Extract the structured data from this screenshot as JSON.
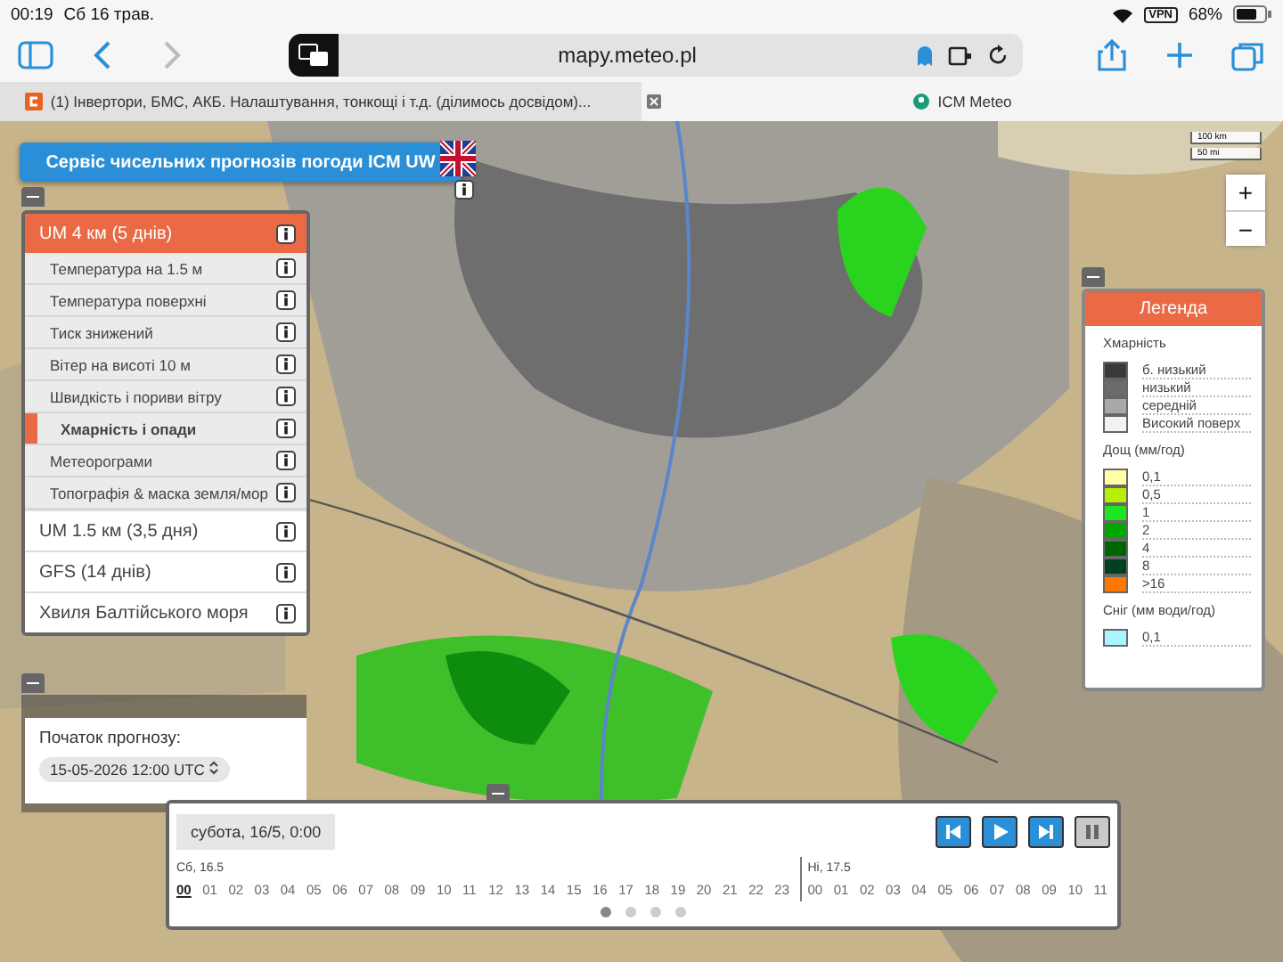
{
  "status_bar": {
    "time": "00:19",
    "date": "Сб 16 трав.",
    "vpn": "VPN",
    "battery": "68%"
  },
  "browser": {
    "url": "mapy.meteo.pl",
    "tabs": [
      {
        "title": "(1) Інвертори, БМС, АКБ. Налаштування, тонкощі і т.д. (ділимось досвідом)...",
        "selected": false
      },
      {
        "title": "ICM Meteo",
        "selected": true
      }
    ]
  },
  "header": "Сервіс чисельних прогнозів погоди ICM UW",
  "scale": [
    "100 km",
    "50 mi"
  ],
  "zoom": [
    "+",
    "−"
  ],
  "models": [
    {
      "label": "UM 4 км (5 днів)",
      "expanded": true,
      "children": [
        {
          "label": "Температура на 1.5 м",
          "selected": false
        },
        {
          "label": "Температура поверхні",
          "selected": false
        },
        {
          "label": "Тиск знижений",
          "selected": false
        },
        {
          "label": "Вітер на висоті 10 м",
          "selected": false
        },
        {
          "label": "Швидкість і пориви вітру",
          "selected": false
        },
        {
          "label": "Хмарність і опади",
          "selected": true
        },
        {
          "label": "Метеорограми",
          "selected": false
        },
        {
          "label": "Топографія & маска земля/мор",
          "selected": false
        }
      ]
    },
    {
      "label": "UM 1.5 км (3,5 дня)",
      "expanded": false
    },
    {
      "label": "GFS (14 днів)",
      "expanded": false
    },
    {
      "label": "Хвиля Балтійського моря",
      "expanded": false
    }
  ],
  "forecast_start": {
    "label": "Початок прогнозу:",
    "value": "15-05-2026 12:00 UTC"
  },
  "legend": {
    "title": "Легенда",
    "sections": [
      {
        "title": "Хмарність",
        "items": [
          {
            "label": "б. низький",
            "color": "#3a3a3a"
          },
          {
            "label": "низький",
            "color": "#6b6b6b"
          },
          {
            "label": "середній",
            "color": "#a8a8a8"
          },
          {
            "label": "Високий поверх",
            "color": "#f2f2f2"
          }
        ]
      },
      {
        "title": "Дощ (мм/год)",
        "items": [
          {
            "label": "0,1",
            "color": "#ffffa8"
          },
          {
            "label": "0,5",
            "color": "#b4f000"
          },
          {
            "label": "1",
            "color": "#1ee61e"
          },
          {
            "label": "2",
            "color": "#00a800"
          },
          {
            "label": "4",
            "color": "#006400"
          },
          {
            "label": "8",
            "color": "#004020"
          },
          {
            "label": ">16",
            "color": "#ff7800"
          }
        ]
      },
      {
        "title": "Сніг (мм води/год)",
        "items": [
          {
            "label": "0,1",
            "color": "#a8f4ff"
          }
        ]
      }
    ]
  },
  "timeline": {
    "current": "субота, 16/5, 0:00",
    "controls": [
      {
        "kind": "first",
        "disabled": false
      },
      {
        "kind": "play",
        "disabled": false
      },
      {
        "kind": "last",
        "disabled": false
      },
      {
        "kind": "pause",
        "disabled": true
      }
    ],
    "days": [
      {
        "label": "Сб, 16.5",
        "hours": [
          {
            "label": "00",
            "selected": true
          },
          {
            "label": "01",
            "selected": false
          },
          {
            "label": "02",
            "selected": false
          },
          {
            "label": "03",
            "selected": false
          },
          {
            "label": "04",
            "selected": false
          },
          {
            "label": "05",
            "selected": false
          },
          {
            "label": "06",
            "selected": false
          },
          {
            "label": "07",
            "selected": false
          },
          {
            "label": "08",
            "selected": false
          },
          {
            "label": "09",
            "selected": false
          },
          {
            "label": "10",
            "selected": false
          },
          {
            "label": "11",
            "selected": false
          },
          {
            "label": "12",
            "selected": false
          },
          {
            "label": "13",
            "selected": false
          },
          {
            "label": "14",
            "selected": false
          },
          {
            "label": "15",
            "selected": false
          },
          {
            "label": "16",
            "selected": false
          },
          {
            "label": "17",
            "selected": false
          },
          {
            "label": "18",
            "selected": false
          },
          {
            "label": "19",
            "selected": false
          },
          {
            "label": "20",
            "selected": false
          },
          {
            "label": "21",
            "selected": false
          },
          {
            "label": "22",
            "selected": false
          },
          {
            "label": "23",
            "selected": false
          }
        ]
      },
      {
        "label": "Ні, 17.5",
        "hours": [
          {
            "label": "00",
            "selected": false
          },
          {
            "label": "01",
            "selected": false
          },
          {
            "label": "02",
            "selected": false
          },
          {
            "label": "03",
            "selected": false
          },
          {
            "label": "04",
            "selected": false
          },
          {
            "label": "05",
            "selected": false
          },
          {
            "label": "06",
            "selected": false
          },
          {
            "label": "07",
            "selected": false
          },
          {
            "label": "08",
            "selected": false
          },
          {
            "label": "09",
            "selected": false
          },
          {
            "label": "10",
            "selected": false
          },
          {
            "label": "11",
            "selected": false
          }
        ]
      }
    ],
    "pages": [
      {
        "selected": true
      },
      {
        "selected": false
      },
      {
        "selected": false
      },
      {
        "selected": false
      }
    ]
  }
}
